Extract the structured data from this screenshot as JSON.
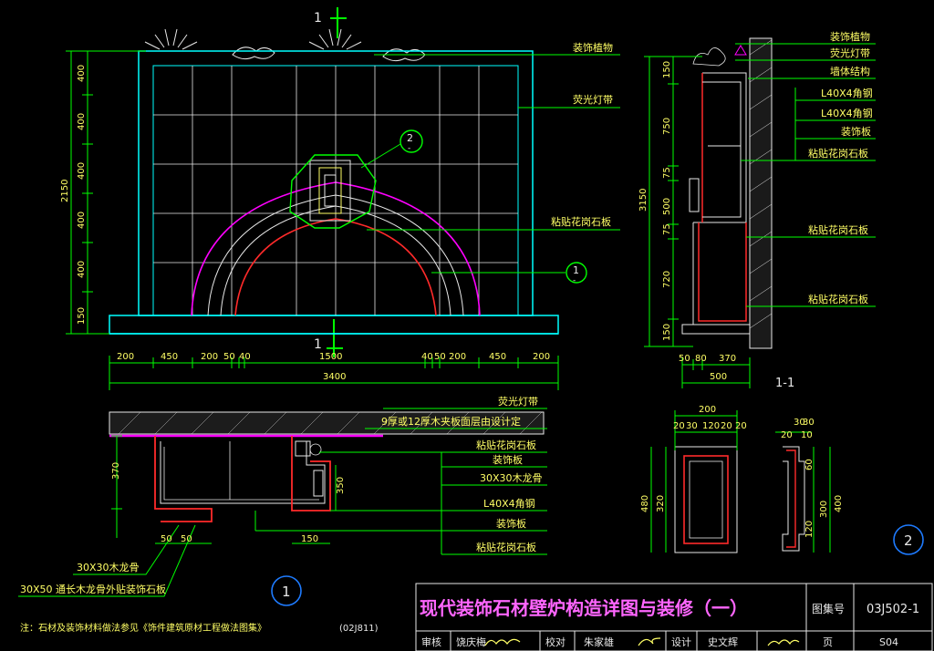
{
  "colors": {
    "background": "#000000",
    "outline_cyan": "#00ffff",
    "grid_white": "#e8e8e8",
    "dimension_green": "#00ff00",
    "arch_magenta": "#ff00ff",
    "arch_red": "#ff2a2a",
    "label_yellow": "#ffff66",
    "title_magenta": "#ff66ff",
    "accent_blue": "#1e7bff"
  },
  "section_markers": {
    "top": "1",
    "bottom": "1"
  },
  "front_elevation": {
    "top_labels": [
      "装饰植物",
      "荧光灯带"
    ],
    "arch_label": "粘贴花岗石板",
    "callout_detail": "2",
    "callout_sub": "-",
    "callout_section": "1",
    "callout_section_sub": "-",
    "vertical_dims": [
      "400",
      "400",
      "400",
      "400",
      "400",
      "150"
    ],
    "overall_height": "2150",
    "horizontal_dims": [
      "200",
      "450",
      "200",
      "50",
      "40",
      "1500",
      "40",
      "50",
      "200",
      "450",
      "200"
    ],
    "overall_width": "3400"
  },
  "section_view": {
    "labels": [
      "装饰植物",
      "荧光灯带",
      "墙体结构",
      "L40X4角钢",
      "L40X4角钢",
      "装饰板",
      "粘贴花岗石板",
      "粘贴花岗石板",
      "粘贴花岗石板"
    ],
    "vertical_dims": [
      "150",
      "750",
      "75",
      "500",
      "75",
      "720",
      "150"
    ],
    "overall_height": "3150",
    "bottom_dims": [
      "50",
      "80",
      "370",
      "500"
    ],
    "title": "1-1"
  },
  "plan_view": {
    "labels": [
      "荧光灯带",
      "9厚或12厚木夹板面层由设计定",
      "粘贴花岗石板",
      "装饰板",
      "30X30木龙骨",
      "L40X4角钢",
      "装饰板",
      "粘贴花岗石板"
    ],
    "left_labels": [
      "30X30木龙骨",
      "30X50 通长木龙骨外贴装饰石板"
    ],
    "dims": [
      "370",
      "350",
      "50",
      "50",
      "150"
    ],
    "detail_number": "1"
  },
  "detail_two": {
    "top_dims": [
      "200",
      "20",
      "30",
      "120",
      "20",
      "20",
      "20",
      "30",
      "10",
      "30"
    ],
    "side_dims": [
      "480",
      "320",
      "60",
      "120",
      "300",
      "400"
    ],
    "detail_number": "2"
  },
  "note": "注：石材及装饰材料做法参见《饰件建筑原材工程做法图集》",
  "note_ref": "(02J811)",
  "title_block": {
    "title": "现代装饰石材壁炉构造详图与装修（一）",
    "atlas_label": "图集号",
    "atlas_number": "03J502-1",
    "row": [
      "审核",
      "饶庆梅",
      "校对",
      "朱家雄",
      "设计",
      "史文辉",
      "页"
    ],
    "page": "S04"
  }
}
